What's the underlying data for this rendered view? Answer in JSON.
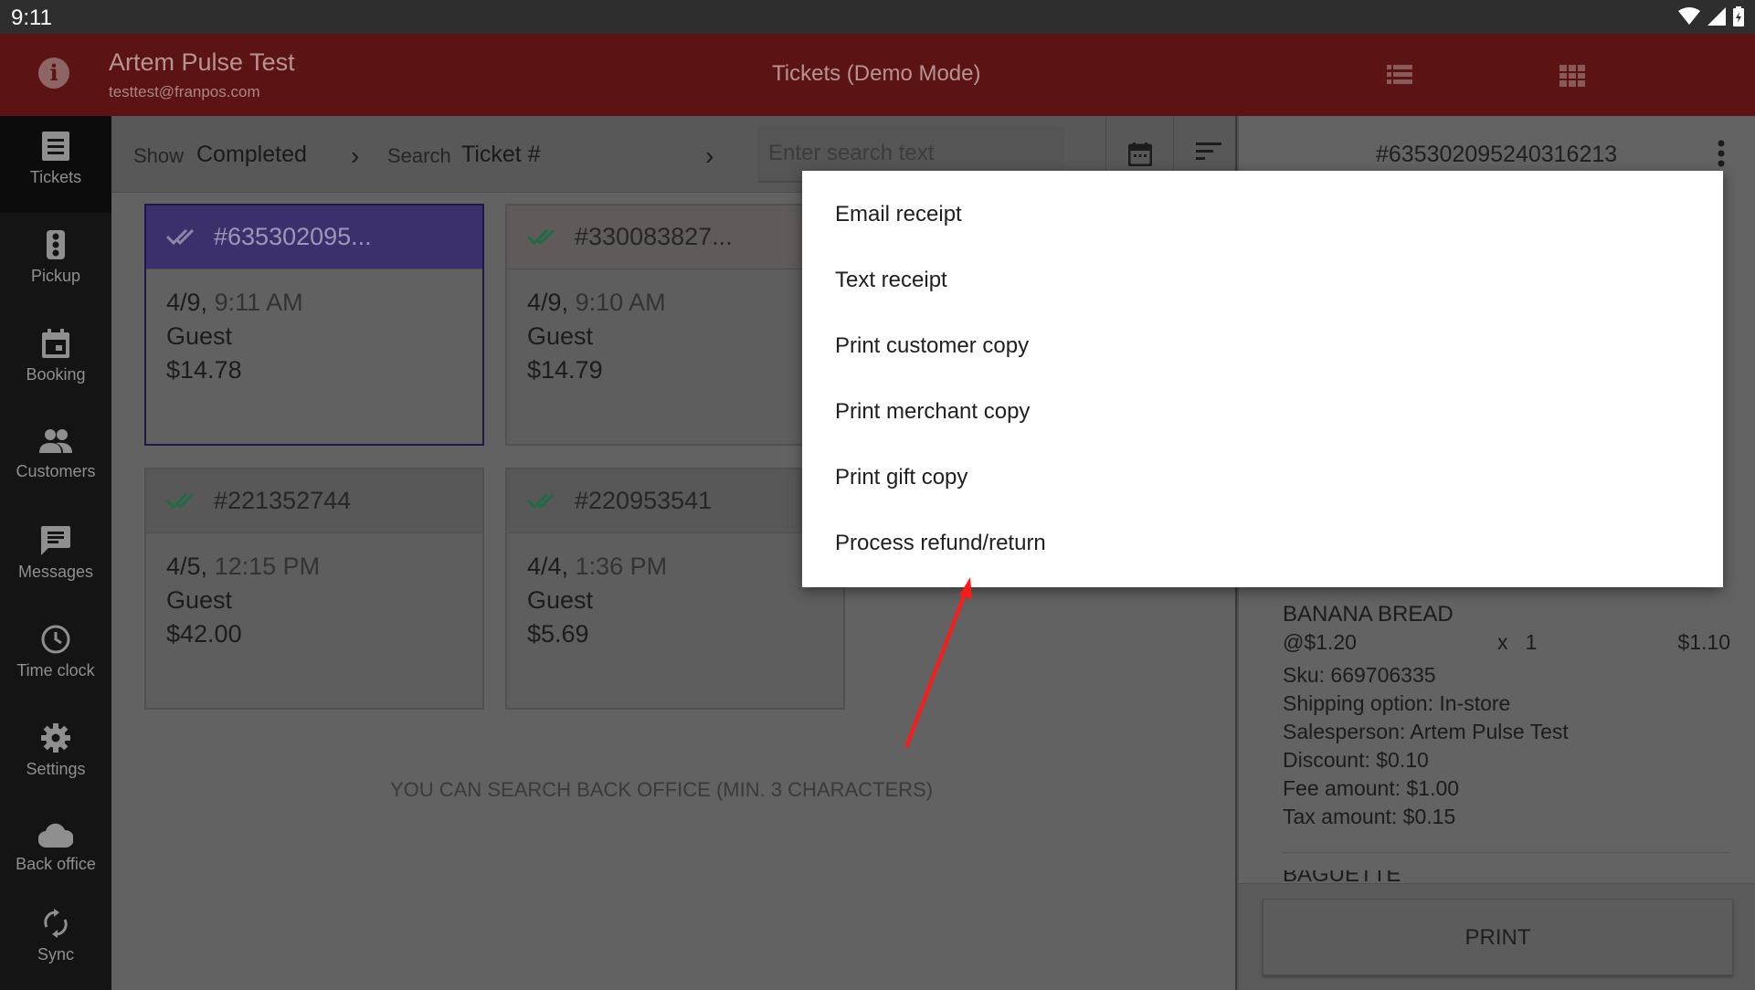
{
  "status_bar": {
    "time": "9:11"
  },
  "app_bar": {
    "user_name": "Artem  Pulse Test",
    "user_email": "testtest@franpos.com",
    "title": "Tickets (Demo Mode)"
  },
  "sidebar": {
    "items": [
      {
        "label": "Tickets",
        "icon": "receipt-icon",
        "active": true
      },
      {
        "label": "Pickup",
        "icon": "traffic-light-icon"
      },
      {
        "label": "Booking",
        "icon": "calendar-icon"
      },
      {
        "label": "Customers",
        "icon": "people-icon"
      },
      {
        "label": "Messages",
        "icon": "message-icon"
      },
      {
        "label": "Time clock",
        "icon": "clock-icon"
      },
      {
        "label": "Settings",
        "icon": "gear-icon"
      },
      {
        "label": "Back office",
        "icon": "cloud-icon"
      },
      {
        "label": "Sync",
        "icon": "sync-icon"
      }
    ]
  },
  "toolbar": {
    "show_label": "Show",
    "show_value": "Completed",
    "search_label": "Search",
    "search_value": "Ticket #",
    "search_placeholder": "Enter search text"
  },
  "tickets": [
    {
      "number": "#635302095...",
      "date": "4/9,",
      "time": "9:11 AM",
      "customer": "Guest",
      "amount": "$14.78",
      "selected": true
    },
    {
      "number": "#330083827...",
      "date": "4/9,",
      "time": "9:10 AM",
      "customer": "Guest",
      "amount": "$14.79"
    },
    {
      "number": "#221352744",
      "date": "4/5,",
      "time": "12:15 PM",
      "customer": "Guest",
      "amount": "$42.00"
    },
    {
      "number": "#220953541",
      "date": "4/4,",
      "time": "1:36 PM",
      "customer": "Guest",
      "amount": "$5.69"
    }
  ],
  "hint": "YOU CAN SEARCH BACK OFFICE (MIN. 3 CHARACTERS)",
  "detail": {
    "ticket_number": "#635302095240316213",
    "item": {
      "name": "BANANA BREAD",
      "unit_price": "@$1.20",
      "qty_sep": "x",
      "qty": "1",
      "total": "$1.10",
      "sku": "Sku: 669706335",
      "shipping": "Shipping option: In-store",
      "salesperson": "Salesperson: Artem Pulse Test",
      "discount": "Discount: $0.10",
      "fee": "Fee amount: $1.00",
      "tax": "Tax amount: $0.15"
    },
    "next_item": "BAGUETTE",
    "print_label": "PRINT"
  },
  "menu": {
    "items": [
      "Email receipt",
      "Text receipt",
      "Print customer copy",
      "Print merchant copy",
      "Print gift copy",
      "Process refund/return"
    ]
  },
  "colors": {
    "app_bar": "#5c1313",
    "selected_card_header": "#3d2f6c",
    "check_green": "#1f6b45",
    "annotation_arrow": "#ff1a1a"
  }
}
